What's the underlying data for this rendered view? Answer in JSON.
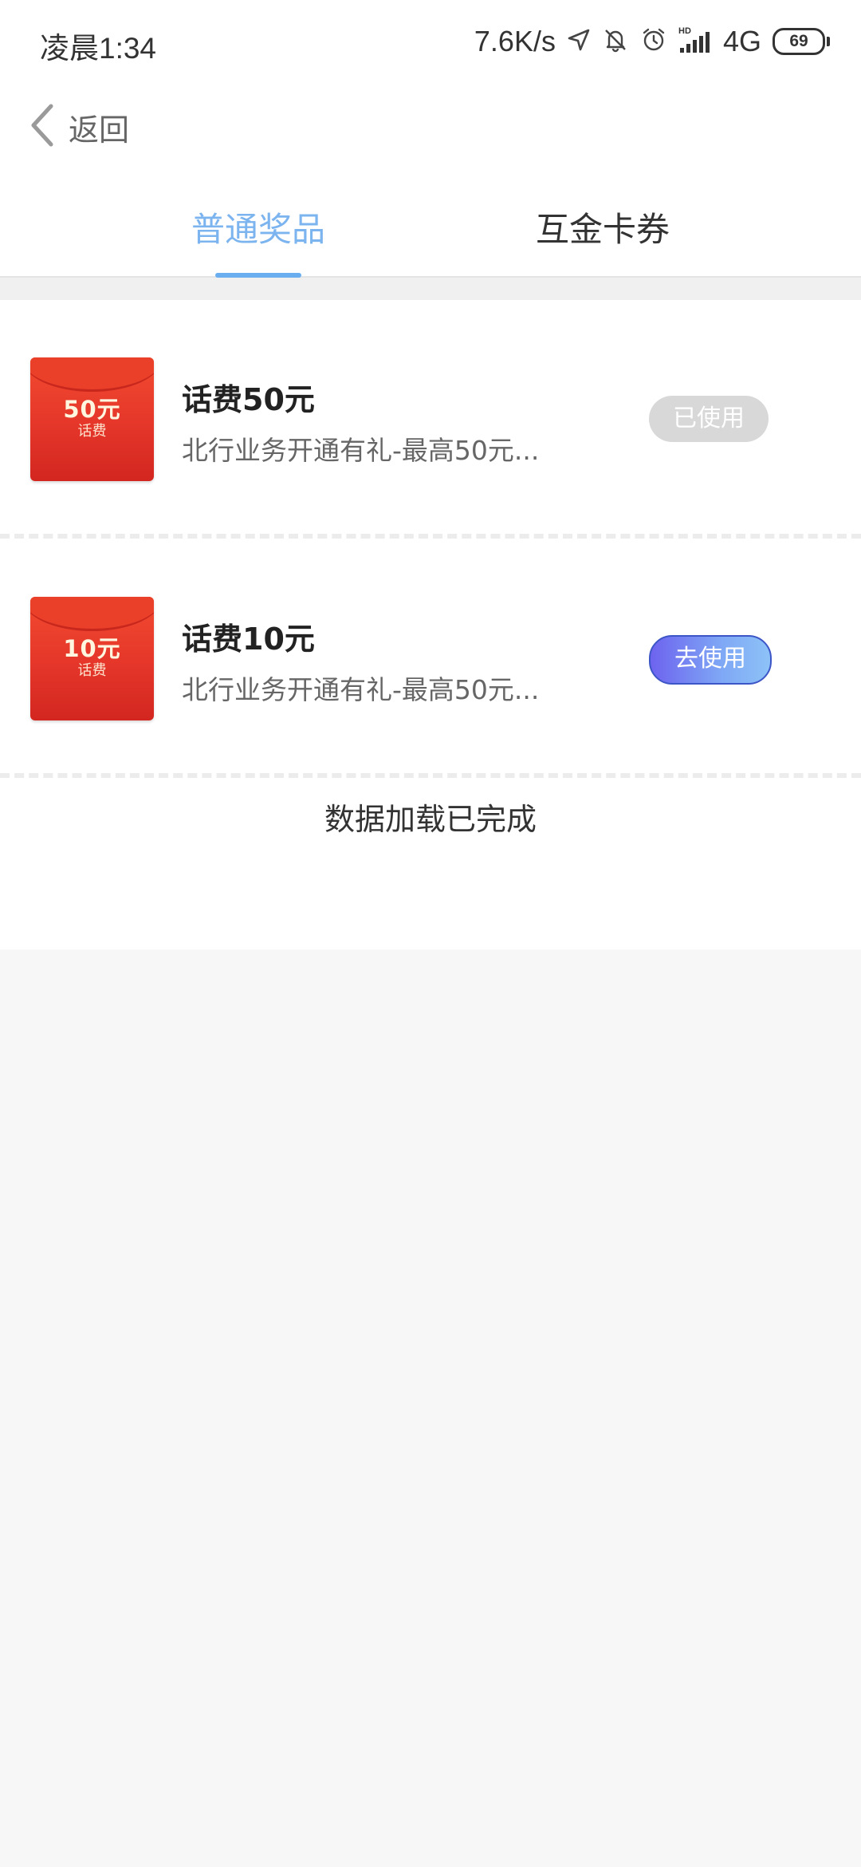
{
  "status_bar": {
    "time": "凌晨1:34",
    "net_speed": "7.6K/s",
    "network": "4G",
    "battery": "69",
    "icons": [
      "location-icon",
      "mute-icon",
      "alarm-icon",
      "hd-signal-icon",
      "battery-icon"
    ]
  },
  "nav": {
    "back_label": "返回"
  },
  "tabs": [
    {
      "label": "普通奖品",
      "active": true
    },
    {
      "label": "互金卡券",
      "active": false
    }
  ],
  "items": [
    {
      "thumb_amount": "50元",
      "thumb_sub": "话费",
      "title": "话费50元",
      "desc": "北行业务开通有礼-最高50元...",
      "action": "已使用",
      "used": true
    },
    {
      "thumb_amount": "10元",
      "thumb_sub": "话费",
      "title": "话费10元",
      "desc": "北行业务开通有礼-最高50元...",
      "action": "去使用",
      "used": false
    }
  ],
  "load_status": "数据加载已完成",
  "colors": {
    "tab_active": "#7bb4ee",
    "tab_indicator": "#6aaef0",
    "used_button": "#d8d8d8",
    "use_button_start": "#6d63ef",
    "use_button_end": "#8dc2f7",
    "red_packet": "#e5362a"
  }
}
